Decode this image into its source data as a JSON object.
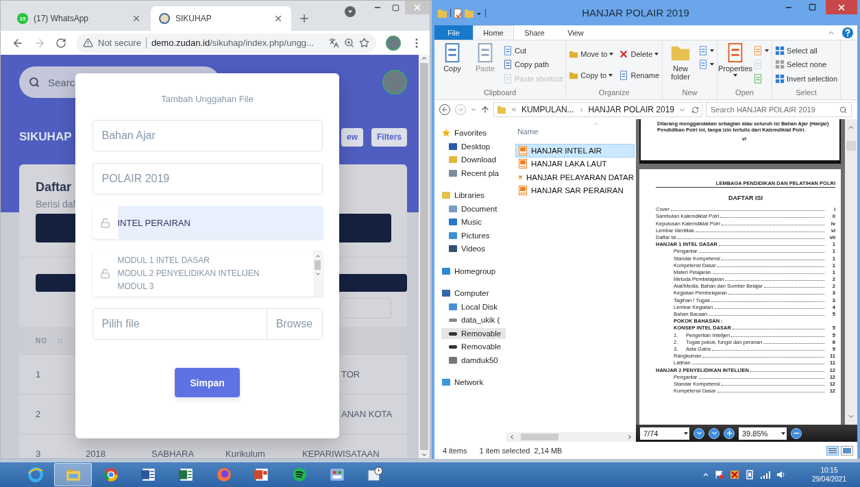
{
  "browser": {
    "tabs": [
      {
        "label": "(17) WhatsApp",
        "badge": "15",
        "selected": false
      },
      {
        "label": "SIKUHAP",
        "selected": true
      }
    ],
    "address": {
      "security": "Not secure",
      "host": "demo.zudan.id",
      "path": "/sikuhap/index.php/ungg..."
    }
  },
  "page": {
    "search": {
      "placeholder": "Searc"
    },
    "brand": "SIKUHAP",
    "buttons": [
      "ew",
      "Filters"
    ],
    "card": {
      "title": "Daftar",
      "subtitle": "Berisi daf"
    },
    "table": {
      "columns": [
        "NO"
      ],
      "rows": [
        {
          "no": "1",
          "column_5": "TOR"
        },
        {
          "no": "2",
          "column_5": "ANAN KOTA"
        },
        {
          "no": "3",
          "column_2": "2018",
          "column_3": "SABHARA",
          "column_4": "Kurikulum",
          "column_5": "KEPARIWISATAAN"
        }
      ]
    }
  },
  "modal": {
    "title": "Tambah Unggahan File",
    "fields": [
      {
        "kind": "input",
        "value": "Bahan Ajar"
      },
      {
        "kind": "input",
        "value": "POLAIR 2019"
      },
      {
        "kind": "select",
        "value": "INTEL PERAIRAN"
      },
      {
        "kind": "textarea",
        "lines": [
          "MODUL 1 INTEL DASAR",
          "MODUL 2 PENYELIDIKAN INTELIJEN",
          "MODUL 3"
        ]
      },
      {
        "kind": "file",
        "placeholder": "Pilih file",
        "button": "Browse"
      }
    ],
    "submit": "Simpan"
  },
  "explorer": {
    "title": "HANJAR POLAIR 2019",
    "ribbon_tabs": [
      {
        "label": "File",
        "kind": "file",
        "selected": false
      },
      {
        "label": "Home",
        "kind": "tab",
        "selected": true
      },
      {
        "label": "Share",
        "kind": "tab",
        "selected": false
      },
      {
        "label": "View",
        "kind": "tab",
        "selected": false
      }
    ],
    "groups": [
      {
        "label": "Clipboard",
        "items": [
          {
            "label": "Copy",
            "kind": "large",
            "disabled": false
          },
          {
            "label": "Paste",
            "kind": "large",
            "disabled": true
          },
          {
            "label": "Cut",
            "kind": "small",
            "disabled": false
          },
          {
            "label": "Copy path",
            "kind": "small",
            "disabled": false
          },
          {
            "label": "Paste shortcut",
            "kind": "small",
            "disabled": true
          }
        ]
      },
      {
        "label": "Organize",
        "items": [
          {
            "label": "Move to",
            "kind": "small",
            "dropdown": true,
            "disabled": false
          },
          {
            "label": "Copy to",
            "kind": "small",
            "dropdown": true,
            "disabled": false
          },
          {
            "label": "Delete",
            "kind": "small",
            "dropdown": true,
            "disabled": false
          },
          {
            "label": "Rename",
            "kind": "small",
            "disabled": false
          }
        ]
      },
      {
        "label": "New",
        "items": [
          {
            "label": "New folder",
            "kind": "large",
            "disabled": false
          },
          {
            "kind": "small",
            "dropdown": true,
            "disabled": false
          },
          {
            "kind": "small",
            "dropdown": true,
            "disabled": false
          }
        ]
      },
      {
        "label": "Open",
        "items": [
          {
            "label": "Properties",
            "kind": "large",
            "dropdown": true,
            "disabled": false
          },
          {
            "kind": "small",
            "dropdown": true,
            "disabled": false
          },
          {
            "kind": "small",
            "disabled": true
          },
          {
            "kind": "small",
            "disabled": false
          }
        ]
      },
      {
        "label": "Select",
        "items": [
          {
            "label": "Select all",
            "kind": "small",
            "disabled": false
          },
          {
            "label": "Select none",
            "kind": "small",
            "disabled": false
          },
          {
            "label": "Invert selection",
            "kind": "small",
            "disabled": false
          }
        ]
      }
    ],
    "breadcrumb": [
      "KUMPULAN...",
      "HANJAR POLAIR 2019"
    ],
    "search": {
      "placeholder": "Search HANJAR POLAIR 2019"
    },
    "nav": [
      {
        "label": "Favorites",
        "kind": "star",
        "selected": false,
        "children": [
          {
            "label": "Desktop",
            "kind": "desktop",
            "selected": false
          },
          {
            "label": "Download",
            "kind": "download",
            "selected": false
          },
          {
            "label": "Recent pla",
            "kind": "recent",
            "selected": false
          }
        ]
      },
      {
        "label": "Libraries",
        "kind": "library",
        "selected": false,
        "children": [
          {
            "label": "Document",
            "kind": "document",
            "selected": false
          },
          {
            "label": "Music",
            "kind": "music",
            "selected": false
          },
          {
            "label": "Pictures",
            "kind": "pictures",
            "selected": false
          },
          {
            "label": "Videos",
            "kind": "videos",
            "selected": false
          }
        ]
      },
      {
        "label": "Homegroup",
        "kind": "homegroup",
        "selected": false
      },
      {
        "label": "Computer",
        "kind": "computer",
        "selected": false,
        "children": [
          {
            "label": "Local Disk",
            "kind": "disk",
            "selected": false
          },
          {
            "label": "data_ukik (",
            "kind": "drive",
            "selected": false
          },
          {
            "label": "Removable",
            "kind": "removable",
            "selected": true
          },
          {
            "label": "Removable",
            "kind": "removable",
            "selected": false
          },
          {
            "label": "damduk50",
            "kind": "usb",
            "selected": false
          }
        ]
      },
      {
        "label": "Network",
        "kind": "network",
        "selected": false
      }
    ],
    "files": {
      "column": "Name",
      "items": [
        {
          "name": "HANJAR INTEL AIR",
          "selected": true
        },
        {
          "name": "HANJAR LAKA LAUT",
          "selected": false
        },
        {
          "name": "HANJAR PELAYARAN DATAR",
          "selected": false
        },
        {
          "name": "HANJAR SAR PERAIRAN",
          "selected": false
        }
      ]
    },
    "preview": {
      "note": "Dilarang menggandakan sebagian atau seluruh isi Bahan Ajar (Hanjar) Pendidikan Polri ini, tanpa izin tertulis dari Kalemdiklat Polri.",
      "note_page": "vi",
      "header": "LEMBAGA PENDIDIKAN DAN PELATIHAN POLRI",
      "title": "DAFTAR ISI",
      "toc": [
        {
          "label": "Cover",
          "page": "i"
        },
        {
          "label": "Sambutan Kalemdiklat Polri",
          "page": "ii"
        },
        {
          "label": "Keputusan Kalemdiklat Polri",
          "page": "iv"
        },
        {
          "label": "Lembar Identitas",
          "page": "vi"
        },
        {
          "label": "Daftar isi",
          "page": "vii"
        },
        {
          "label": "HANJAR 1 INTEL DASAR",
          "page": "1",
          "kind": "heading",
          "children": [
            {
              "label": "Pengantar",
              "page": "1"
            },
            {
              "label": "Standar Kompetensi",
              "page": "1"
            },
            {
              "label": "Kompetensi Dasar",
              "page": "1"
            },
            {
              "label": "Materi Pelajaran",
              "page": "1"
            },
            {
              "label": "Metoda Pembelajaran",
              "page": "2"
            },
            {
              "label": "Alat/Media, Bahan dan Sumber Belajar",
              "page": "2"
            },
            {
              "label": "Kegiatan Pembelajaran",
              "page": "3"
            },
            {
              "label": "Tagihan / Tugas",
              "page": "3"
            },
            {
              "label": "Lembar Kegiatan",
              "page": "4"
            },
            {
              "label": "Bahan Bacaan",
              "page": "5"
            },
            {
              "label": "POKOK BAHASAN :",
              "kind": "heading"
            },
            {
              "label": "KONSEP INTEL DASAR",
              "page": "5",
              "kind": "heading"
            },
            {
              "num": "1.",
              "label": "Pengertian Intelijen",
              "page": "5"
            },
            {
              "num": "2.",
              "label": "Tugas pokok, fungsi dan peranan",
              "page": "6"
            },
            {
              "num": "3.",
              "label": "Asta Gatra",
              "page": "9"
            },
            {
              "label": "Rangkuman",
              "page": "11"
            },
            {
              "label": "Latihan",
              "page": "11"
            }
          ]
        },
        {
          "label": "HANJAR 2 PENYELIDIKAN INTELIJEN",
          "page": "12",
          "kind": "heading",
          "children": [
            {
              "label": "Pengantar",
              "page": "12"
            },
            {
              "label": "Standar Kompetensi",
              "page": "12"
            },
            {
              "label": "Kompetensi Dasar",
              "page": "12"
            }
          ]
        }
      ],
      "page_field": "7/74",
      "zoom_field": "39.85%"
    },
    "status": {
      "count": "4 items",
      "selection": "1 item selected",
      "size": "2,14 MB"
    }
  },
  "taskbar": {
    "apps": [
      {
        "kind": "ie",
        "selected": false
      },
      {
        "kind": "explorer",
        "selected": true
      },
      {
        "kind": "chrome",
        "selected": false
      },
      {
        "kind": "word",
        "selected": false
      },
      {
        "kind": "excel",
        "selected": false
      },
      {
        "kind": "firefox",
        "selected": false
      },
      {
        "kind": "powerpoint",
        "selected": false
      },
      {
        "kind": "spotify",
        "selected": false
      },
      {
        "kind": "panel",
        "selected": false
      },
      {
        "kind": "calendar",
        "selected": false
      }
    ],
    "clock": {
      "time": "10:15",
      "date": "29/04/2021"
    }
  }
}
